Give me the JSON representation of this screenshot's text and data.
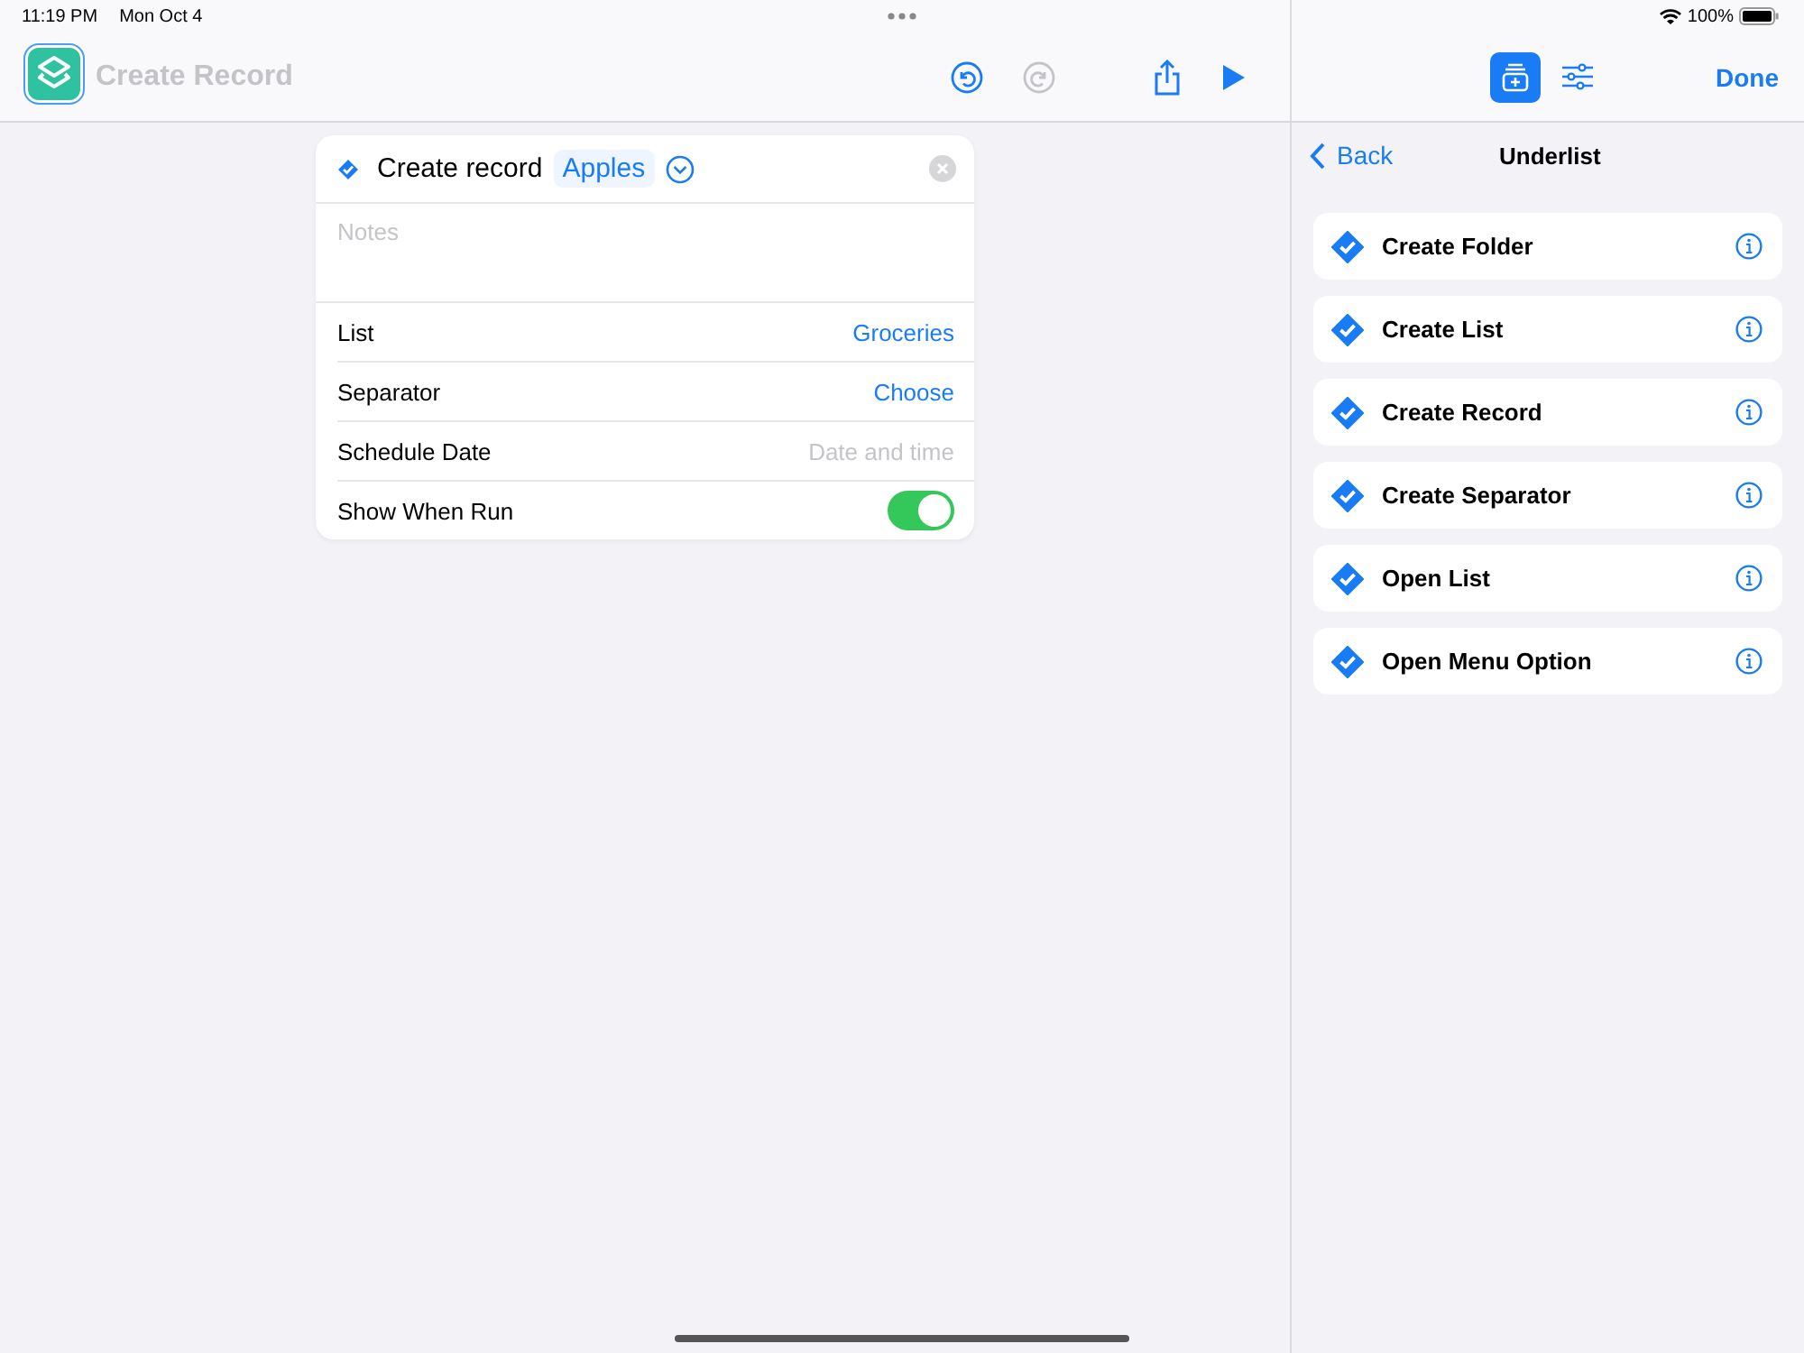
{
  "status_bar": {
    "time": "11:19 PM",
    "date": "Mon Oct 4",
    "battery": "100%"
  },
  "toolbar": {
    "title": "Create Record",
    "buttons": [
      {
        "kind": "undo",
        "disabled": false
      },
      {
        "kind": "redo",
        "disabled": true
      },
      {
        "kind": "share",
        "disabled": false
      },
      {
        "kind": "play",
        "disabled": false
      }
    ]
  },
  "action_card": {
    "title": "Create record",
    "token": "Apples",
    "notes": {
      "placeholder": "Notes"
    },
    "params": [
      {
        "kind": "link",
        "label": "List",
        "value": "Groceries"
      },
      {
        "kind": "link",
        "label": "Separator",
        "value": "Choose"
      },
      {
        "kind": "placeholder",
        "label": "Schedule Date",
        "placeholder": "Date and time"
      },
      {
        "kind": "toggle",
        "label": "Show When Run",
        "on": true
      }
    ]
  },
  "sidebar": {
    "tabs": [
      {
        "kind": "add",
        "selected": true
      },
      {
        "kind": "settings",
        "selected": false
      }
    ],
    "done": "Done",
    "back": "Back",
    "title": "Underlist",
    "actions": [
      {
        "label": "Create Folder"
      },
      {
        "label": "Create List"
      },
      {
        "label": "Create Record"
      },
      {
        "label": "Create Separator"
      },
      {
        "label": "Open List"
      },
      {
        "label": "Open Menu Option"
      }
    ]
  }
}
